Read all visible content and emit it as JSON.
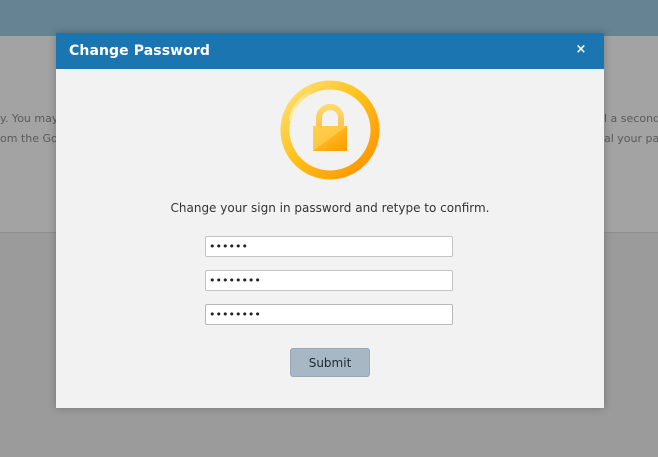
{
  "background": {
    "text_left_line1": "y. You may",
    "text_left_line2": "om the Go",
    "text_right_line1": "l a second",
    "text_right_line2": "al your pa"
  },
  "modal": {
    "title": "Change Password",
    "close_label": "×",
    "instruction": "Change your sign in password and retype to confirm.",
    "fields": [
      {
        "value": "••••••",
        "length": 6
      },
      {
        "value": "••••••••",
        "length": 8
      },
      {
        "value": "••••••••",
        "length": 8
      }
    ],
    "submit_label": "Submit"
  },
  "colors": {
    "header": "#1a75b0",
    "overlay": "#9b9b9b",
    "lock_ring_start": "#ffd34d",
    "lock_ring_end": "#ff9a00",
    "submit_bg": "#a7b8c4"
  }
}
